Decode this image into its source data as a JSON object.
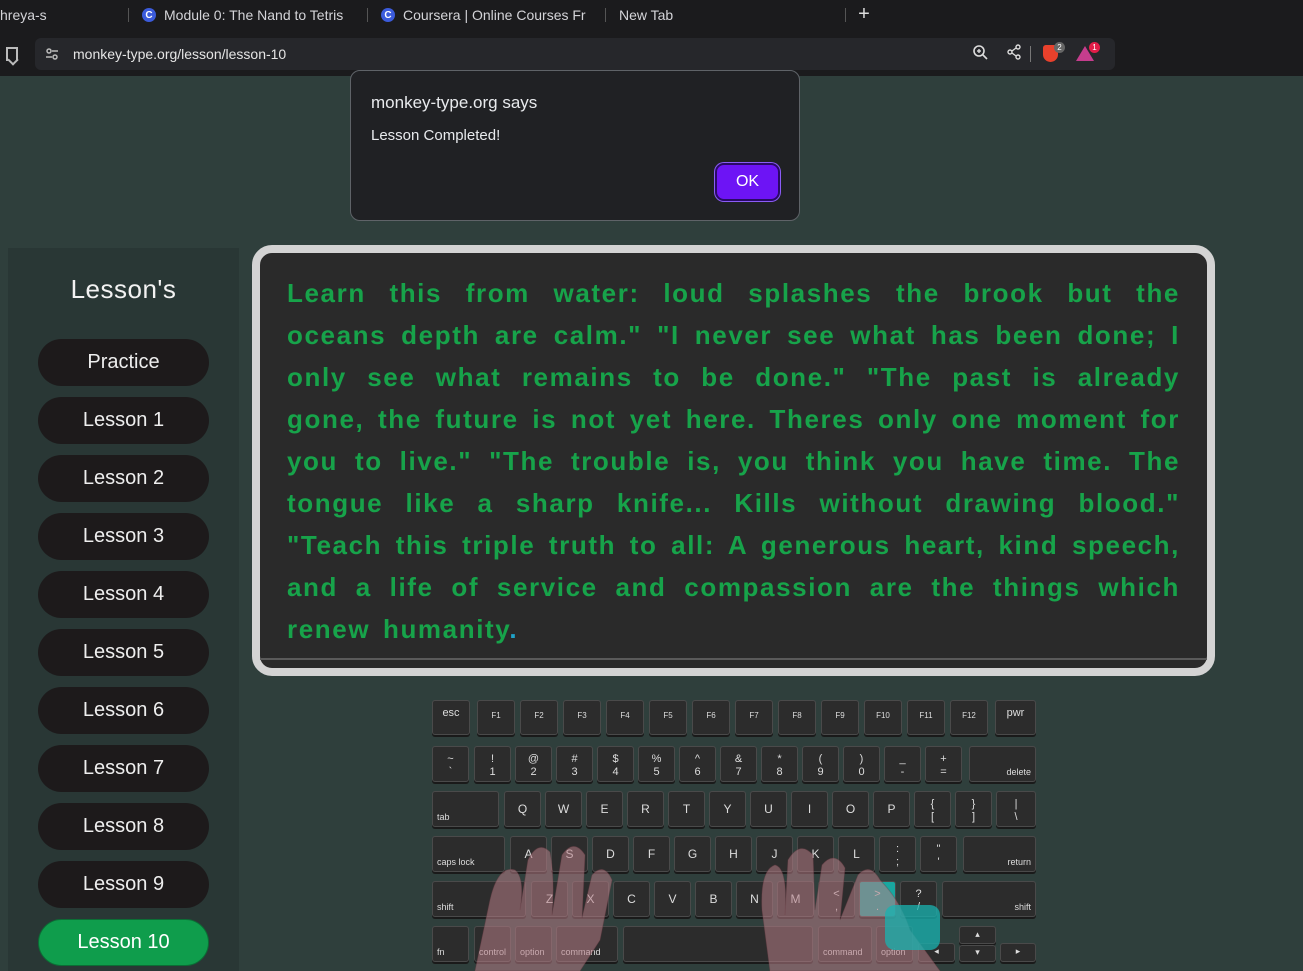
{
  "browser": {
    "tabs": [
      {
        "label": "hreya-s"
      },
      {
        "label": "Module 0: The Nand to Tetris"
      },
      {
        "label": "Coursera | Online Courses Fr"
      },
      {
        "label": "New Tab"
      }
    ],
    "url": "monkey-type.org/lesson/lesson-10",
    "badges": {
      "brave": "2",
      "rewards": "1"
    }
  },
  "dialog": {
    "title": "monkey-type.org says",
    "message": "Lesson Completed!",
    "ok_label": "OK"
  },
  "sidebar": {
    "title": "Lesson's",
    "items": [
      {
        "label": "Practice"
      },
      {
        "label": "Lesson 1"
      },
      {
        "label": "Lesson 2"
      },
      {
        "label": "Lesson 3"
      },
      {
        "label": "Lesson 4"
      },
      {
        "label": "Lesson 5"
      },
      {
        "label": "Lesson 6"
      },
      {
        "label": "Lesson 7"
      },
      {
        "label": "Lesson 8"
      },
      {
        "label": "Lesson 9"
      },
      {
        "label": "Lesson 10"
      }
    ],
    "active": "Lesson 10"
  },
  "lesson": {
    "text": "Learn this from water: loud splashes the brook but the oceans depth are calm.\" \"I never see what has been done; I only see what remains to be done.\" \"The past is already gone, the future is not yet here. Theres only one moment for you to live.\" \"The trouble is, you think you have time. The tongue like a sharp knife... Kills without drawing blood.\" \"Teach this triple truth to all: A generous heart, kind speech, and a life of service and compassion are the things which renew humanity",
    "cursor_char": ".",
    "typed_color": "#17a34a",
    "cursor_color": "#1fa3c9"
  },
  "keyboard": {
    "fn_row": [
      "esc",
      "F1",
      "F2",
      "F3",
      "F4",
      "F5",
      "F6",
      "F7",
      "F8",
      "F9",
      "F10",
      "F11",
      "F12",
      "pwr"
    ],
    "number_row": [
      [
        "~",
        "`"
      ],
      [
        "!",
        "1"
      ],
      [
        "@",
        "2"
      ],
      [
        "#",
        "3"
      ],
      [
        "$",
        "4"
      ],
      [
        "%",
        "5"
      ],
      [
        "^",
        "6"
      ],
      [
        "&",
        "7"
      ],
      [
        "*",
        "8"
      ],
      [
        "(",
        "9"
      ],
      [
        ")",
        "0"
      ],
      [
        "_",
        "-"
      ],
      [
        "+",
        "="
      ]
    ],
    "delete": "delete",
    "tab": "tab",
    "qwerty": [
      "Q",
      "W",
      "E",
      "R",
      "T",
      "Y",
      "U",
      "I",
      "O",
      "P"
    ],
    "brackets": [
      [
        "{",
        "["
      ],
      [
        "}",
        "]"
      ],
      [
        "|",
        "\\"
      ]
    ],
    "caps": "caps lock",
    "home": [
      "A",
      "S",
      "D",
      "F",
      "G",
      "H",
      "J",
      "K",
      "L"
    ],
    "semi": [
      [
        ":",
        ";"
      ],
      [
        "\"",
        "'"
      ]
    ],
    "return": "return",
    "shift": "shift",
    "bottom_letters": [
      "Z",
      "X",
      "C",
      "V",
      "B",
      "N",
      "M"
    ],
    "punct": [
      [
        "<",
        ","
      ],
      [
        ">",
        "."
      ],
      [
        "?",
        "/"
      ]
    ],
    "mods": [
      "fn",
      "control",
      "option",
      "command",
      "command",
      "option"
    ],
    "arrows": [
      "▴",
      "▾",
      "◂",
      "▸"
    ],
    "highlight_key": ">"
  }
}
